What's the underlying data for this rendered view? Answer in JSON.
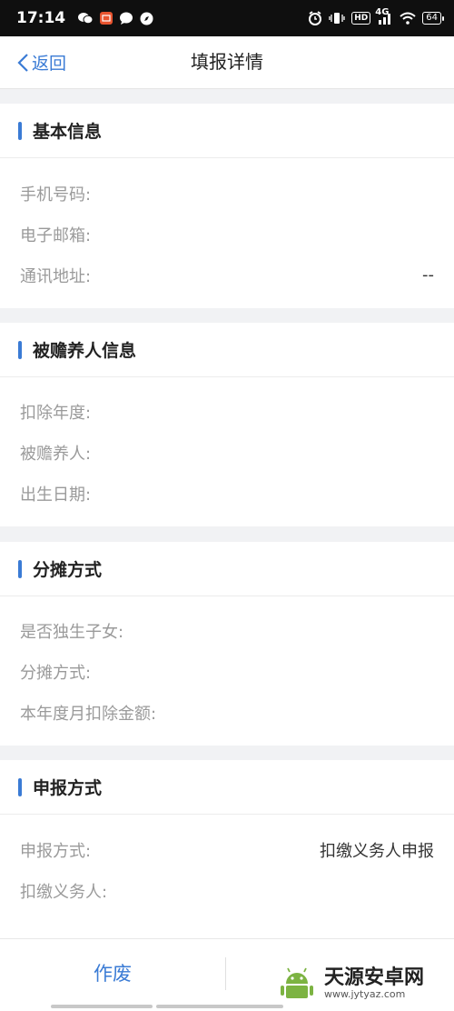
{
  "status_bar": {
    "time": "17:14",
    "left_icons": [
      "wechat-icon",
      "app-notification-icon",
      "chat-bubble-icon",
      "compass-icon"
    ],
    "hd_label": "HD",
    "network_label": "4G",
    "battery_level": "64"
  },
  "nav": {
    "back_label": "返回",
    "title": "填报详情"
  },
  "sections": [
    {
      "title": "基本信息",
      "rows": [
        {
          "label": "手机号码:",
          "value": ""
        },
        {
          "label": "电子邮箱:",
          "value": ""
        },
        {
          "label": "通讯地址:",
          "value": "--"
        }
      ]
    },
    {
      "title": "被赡养人信息",
      "rows": [
        {
          "label": "扣除年度:",
          "value": ""
        },
        {
          "label": "被赡养人:",
          "value": ""
        },
        {
          "label": "出生日期:",
          "value": ""
        }
      ]
    },
    {
      "title": "分摊方式",
      "rows": [
        {
          "label": "是否独生子女:",
          "value": ""
        },
        {
          "label": "分摊方式:",
          "value": ""
        },
        {
          "label": "本年度月扣除金额:",
          "value": ""
        }
      ]
    },
    {
      "title": "申报方式",
      "rows": [
        {
          "label": "申报方式:",
          "value": "扣缴义务人申报"
        },
        {
          "label": "扣缴义务人:",
          "value": ""
        }
      ]
    }
  ],
  "bottom": {
    "void_label": "作废"
  },
  "watermark": {
    "name": "天源安卓网",
    "url": "www.jytyaz.com"
  },
  "colors": {
    "accent": "#3a7bd5",
    "label_gray": "#9a9a9a",
    "background": "#f1f2f4"
  }
}
